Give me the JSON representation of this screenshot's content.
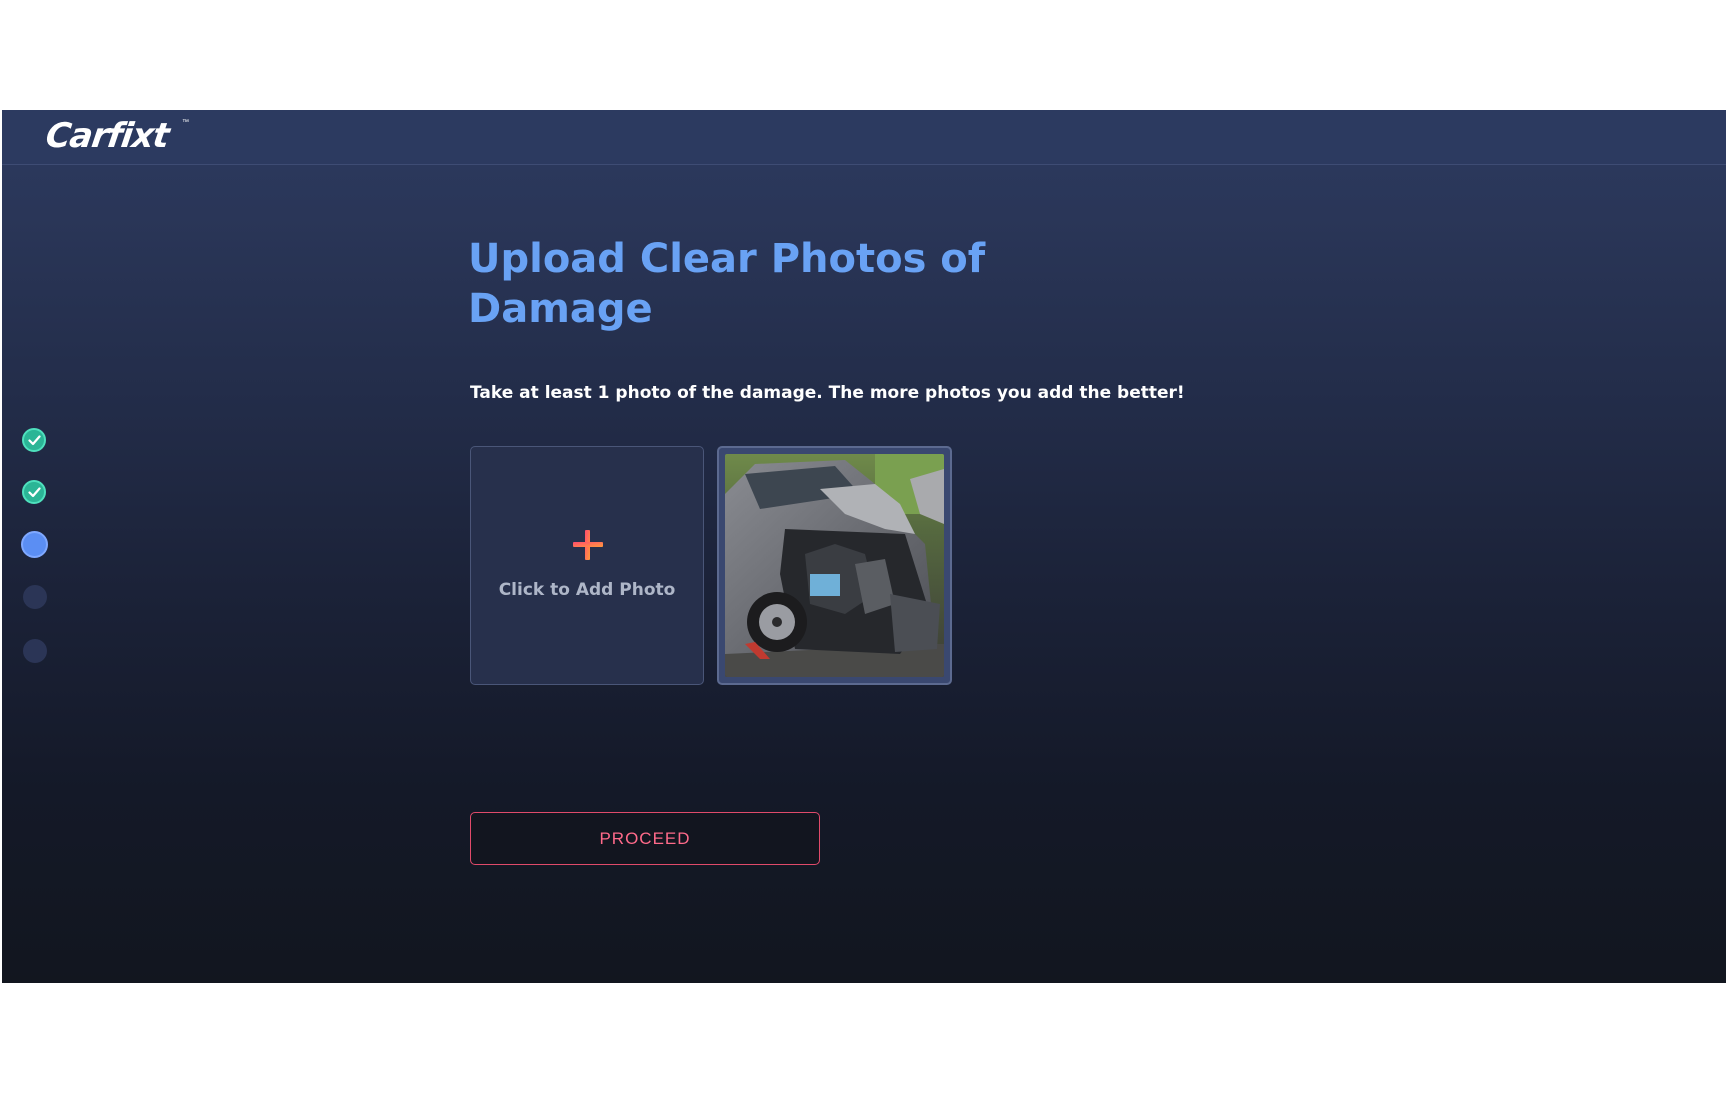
{
  "header": {
    "logo_text": "Carfixt",
    "logo_tm": "™"
  },
  "stepper": {
    "steps": [
      {
        "state": "done"
      },
      {
        "state": "done"
      },
      {
        "state": "current"
      },
      {
        "state": "pending"
      },
      {
        "state": "pending"
      }
    ]
  },
  "main": {
    "title": "Upload Clear Photos of Damage",
    "subtitle": "Take at least 1 photo of the damage. The more photos you add the better!",
    "add_tile": {
      "icon": "plus-icon",
      "label": "Click to Add Photo"
    },
    "photos": [
      {
        "description": "damaged-car-photo"
      }
    ],
    "proceed_label": "PROCEED"
  },
  "colors": {
    "accent_blue": "#69a2f4",
    "step_done": "#2bb596",
    "step_current": "#5b8ef3",
    "proceed_border": "#e04a6a",
    "plus_start": "#ff4d6d",
    "plus_end": "#ff9a3c"
  }
}
